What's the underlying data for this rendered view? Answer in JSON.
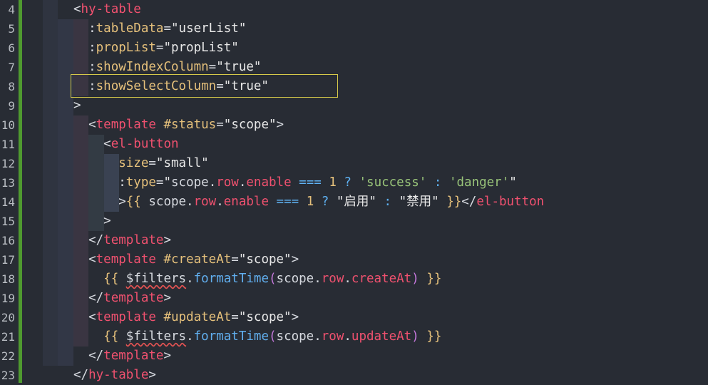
{
  "editor": {
    "gutter_accent": "#4f9a2f",
    "highlight_border": "#d6c94a",
    "lines": [
      {
        "n": "4",
        "tokens": [
          [
            "t-punc",
            "<"
          ],
          [
            "t-tag",
            "hy-table"
          ]
        ]
      },
      {
        "n": "5",
        "tokens": [
          [
            "t-plain",
            "  "
          ],
          [
            "t-punc",
            ":"
          ],
          [
            "t-attr",
            "tableData"
          ],
          [
            "t-punc",
            "="
          ],
          [
            "t-str",
            "\"userList\""
          ]
        ]
      },
      {
        "n": "6",
        "tokens": [
          [
            "t-plain",
            "  "
          ],
          [
            "t-punc",
            ":"
          ],
          [
            "t-attr",
            "propList"
          ],
          [
            "t-punc",
            "="
          ],
          [
            "t-str",
            "\"propList\""
          ]
        ]
      },
      {
        "n": "7",
        "tokens": [
          [
            "t-plain",
            "  "
          ],
          [
            "t-punc",
            ":"
          ],
          [
            "t-attr",
            "showIndexColumn"
          ],
          [
            "t-punc",
            "="
          ],
          [
            "t-str",
            "\"true\""
          ]
        ]
      },
      {
        "n": "8",
        "tokens": [
          [
            "t-plain",
            "  "
          ],
          [
            "t-punc",
            ":"
          ],
          [
            "t-attr",
            "showSelectColumn"
          ],
          [
            "t-punc",
            "="
          ],
          [
            "t-str",
            "\"true\""
          ]
        ]
      },
      {
        "n": "9",
        "tokens": [
          [
            "t-punc",
            ">"
          ]
        ]
      },
      {
        "n": "10",
        "tokens": [
          [
            "t-plain",
            "  "
          ],
          [
            "t-punc",
            "<"
          ],
          [
            "t-tag",
            "template"
          ],
          [
            "t-plain",
            " "
          ],
          [
            "t-attr",
            "#status"
          ],
          [
            "t-punc",
            "="
          ],
          [
            "t-str",
            "\"scope\""
          ],
          [
            "t-punc",
            ">"
          ]
        ]
      },
      {
        "n": "11",
        "tokens": [
          [
            "t-plain",
            "    "
          ],
          [
            "t-punc",
            "<"
          ],
          [
            "t-tag",
            "el-button"
          ]
        ]
      },
      {
        "n": "12",
        "tokens": [
          [
            "t-plain",
            "      "
          ],
          [
            "t-attr",
            "size"
          ],
          [
            "t-punc",
            "="
          ],
          [
            "t-str",
            "\"small\""
          ]
        ]
      },
      {
        "n": "13",
        "tokens": [
          [
            "t-plain",
            "      "
          ],
          [
            "t-punc",
            ":"
          ],
          [
            "t-attr",
            "type"
          ],
          [
            "t-punc",
            "="
          ],
          [
            "t-str",
            "\""
          ],
          [
            "t-plain",
            "scope."
          ],
          [
            "t-prop",
            "row"
          ],
          [
            "t-plain",
            "."
          ],
          [
            "t-prop",
            "enable"
          ],
          [
            "t-plain",
            " "
          ],
          [
            "t-op",
            "==="
          ],
          [
            "t-plain",
            " "
          ],
          [
            "t-num",
            "1"
          ],
          [
            "t-plain",
            " "
          ],
          [
            "t-op",
            "?"
          ],
          [
            "t-plain",
            " "
          ],
          [
            "t-sq",
            "'success'"
          ],
          [
            "t-plain",
            " "
          ],
          [
            "t-op",
            ":"
          ],
          [
            "t-plain",
            " "
          ],
          [
            "t-sq",
            "'danger'"
          ],
          [
            "t-str",
            "\""
          ]
        ]
      },
      {
        "n": "14",
        "tokens": [
          [
            "t-plain",
            "      "
          ],
          [
            "t-punc",
            ">"
          ],
          [
            "t-brace",
            "{{"
          ],
          [
            "t-plain",
            " scope."
          ],
          [
            "t-prop",
            "row"
          ],
          [
            "t-plain",
            "."
          ],
          [
            "t-prop",
            "enable"
          ],
          [
            "t-plain",
            " "
          ],
          [
            "t-op",
            "==="
          ],
          [
            "t-plain",
            " "
          ],
          [
            "t-num",
            "1"
          ],
          [
            "t-plain",
            " "
          ],
          [
            "t-op",
            "?"
          ],
          [
            "t-plain",
            " "
          ],
          [
            "t-str",
            "\"启用\""
          ],
          [
            "t-plain",
            " "
          ],
          [
            "t-op",
            ":"
          ],
          [
            "t-plain",
            " "
          ],
          [
            "t-str",
            "\"禁用\""
          ],
          [
            "t-plain",
            " "
          ],
          [
            "t-brace",
            "}}"
          ],
          [
            "t-punc",
            "</"
          ],
          [
            "t-tag",
            "el-button"
          ]
        ]
      },
      {
        "n": "15",
        "tokens": [
          [
            "t-plain",
            "    "
          ],
          [
            "t-punc",
            ">"
          ]
        ]
      },
      {
        "n": "16",
        "tokens": [
          [
            "t-plain",
            "  "
          ],
          [
            "t-punc",
            "</"
          ],
          [
            "t-tag",
            "template"
          ],
          [
            "t-punc",
            ">"
          ]
        ]
      },
      {
        "n": "17",
        "tokens": [
          [
            "t-plain",
            "  "
          ],
          [
            "t-punc",
            "<"
          ],
          [
            "t-tag",
            "template"
          ],
          [
            "t-plain",
            " "
          ],
          [
            "t-attr",
            "#createAt"
          ],
          [
            "t-punc",
            "="
          ],
          [
            "t-str",
            "\"scope\""
          ],
          [
            "t-punc",
            ">"
          ]
        ]
      },
      {
        "n": "18",
        "tokens": [
          [
            "t-plain",
            "    "
          ],
          [
            "t-brace",
            "{{"
          ],
          [
            "t-plain",
            " "
          ],
          [
            "t-plain t-warn",
            "$filters"
          ],
          [
            "t-plain",
            "."
          ],
          [
            "t-fn",
            "formatTime"
          ],
          [
            "t-paren",
            "("
          ],
          [
            "t-plain",
            "scope."
          ],
          [
            "t-prop",
            "row"
          ],
          [
            "t-plain",
            "."
          ],
          [
            "t-prop",
            "createAt"
          ],
          [
            "t-paren",
            ")"
          ],
          [
            "t-plain",
            " "
          ],
          [
            "t-brace",
            "}}"
          ]
        ]
      },
      {
        "n": "19",
        "tokens": [
          [
            "t-plain",
            "  "
          ],
          [
            "t-punc",
            "</"
          ],
          [
            "t-tag",
            "template"
          ],
          [
            "t-punc",
            ">"
          ]
        ]
      },
      {
        "n": "20",
        "tokens": [
          [
            "t-plain",
            "  "
          ],
          [
            "t-punc",
            "<"
          ],
          [
            "t-tag",
            "template"
          ],
          [
            "t-plain",
            " "
          ],
          [
            "t-attr",
            "#updateAt"
          ],
          [
            "t-punc",
            "="
          ],
          [
            "t-str",
            "\"scope\""
          ],
          [
            "t-punc",
            ">"
          ]
        ]
      },
      {
        "n": "21",
        "tokens": [
          [
            "t-plain",
            "    "
          ],
          [
            "t-brace",
            "{{"
          ],
          [
            "t-plain",
            " "
          ],
          [
            "t-plain t-warn",
            "$filters"
          ],
          [
            "t-plain",
            "."
          ],
          [
            "t-fn",
            "formatTime"
          ],
          [
            "t-paren",
            "("
          ],
          [
            "t-plain",
            "scope."
          ],
          [
            "t-prop",
            "row"
          ],
          [
            "t-plain",
            "."
          ],
          [
            "t-prop",
            "updateAt"
          ],
          [
            "t-paren",
            ")"
          ],
          [
            "t-plain",
            " "
          ],
          [
            "t-brace",
            "}}"
          ]
        ]
      },
      {
        "n": "22",
        "tokens": [
          [
            "t-plain",
            "  "
          ],
          [
            "t-punc",
            "</"
          ],
          [
            "t-tag",
            "template"
          ],
          [
            "t-punc",
            ">"
          ]
        ]
      },
      {
        "n": "23",
        "tokens": [
          [
            "t-punc",
            "</"
          ],
          [
            "t-tag",
            "hy-table"
          ],
          [
            "t-punc",
            ">"
          ]
        ]
      }
    ]
  }
}
